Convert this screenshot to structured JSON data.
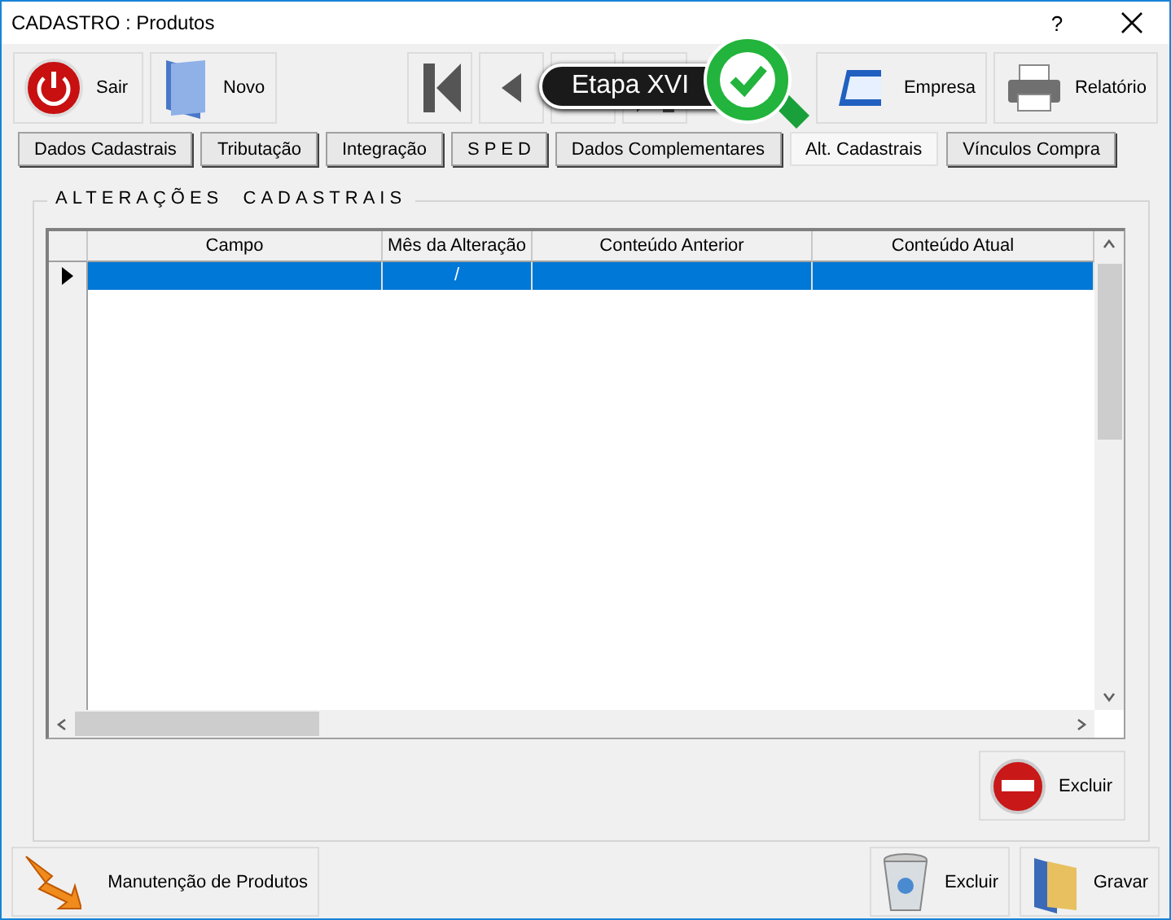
{
  "window": {
    "title": "CADASTRO : Produtos",
    "help": "?"
  },
  "toolbar": [
    {
      "kind": "exit",
      "label": "Sair"
    },
    {
      "kind": "new",
      "label": "Novo"
    },
    {
      "kind": "spacer"
    },
    {
      "kind": "first"
    },
    {
      "kind": "prev"
    },
    {
      "kind": "next"
    },
    {
      "kind": "last"
    },
    {
      "kind": "spacer"
    },
    {
      "kind": "company",
      "label": "Empresa"
    },
    {
      "kind": "printer",
      "label": "Relatório"
    }
  ],
  "tooltip": {
    "text": "Etapa XVI"
  },
  "tabs": [
    {
      "label": "Dados Cadastrais",
      "selected": false
    },
    {
      "label": "Tributação",
      "selected": false
    },
    {
      "label": "Integração",
      "selected": false
    },
    {
      "label": "S P E D",
      "selected": false
    },
    {
      "label": "Dados Complementares",
      "selected": false
    },
    {
      "label": "Alt. Cadastrais",
      "selected": true
    },
    {
      "label": "Vínculos Compra",
      "selected": false
    }
  ],
  "group": {
    "title": "ALTERAÇÕES  CADASTRAIS"
  },
  "table": {
    "columns": [
      "Campo",
      "Mês da Alteração",
      "Conteúdo Anterior",
      "Conteúdo Atual"
    ],
    "rows": [
      {
        "selected": true,
        "cells": [
          "",
          "/",
          "",
          ""
        ]
      }
    ]
  },
  "group_button": {
    "label": "Excluir"
  },
  "footer": [
    {
      "kind": "maint",
      "label": "Manutenção de Produtos"
    },
    {
      "kind": "spacer"
    },
    {
      "kind": "trash",
      "label": "Excluir"
    },
    {
      "kind": "save",
      "label": "Gravar"
    }
  ]
}
